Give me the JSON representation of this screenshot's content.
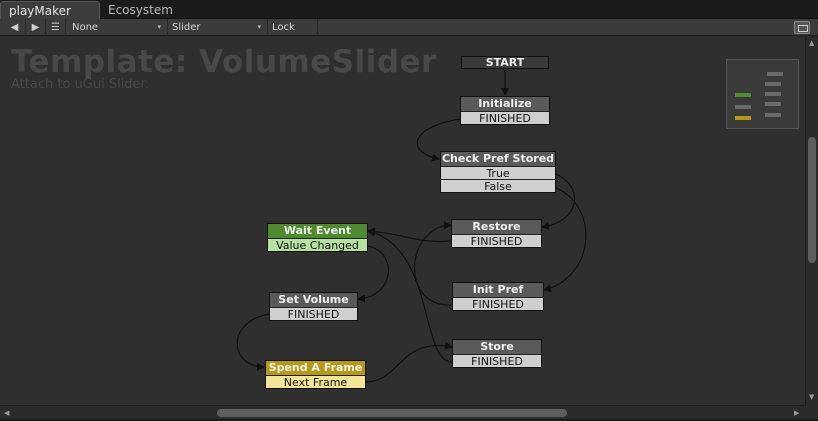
{
  "tabs": [
    {
      "label": "playMaker",
      "active": true
    },
    {
      "label": "Ecosystem",
      "active": false
    }
  ],
  "toolbar": {
    "back_icon": "◀",
    "forward_icon": "▶",
    "menu_icon": "☰",
    "fsm_select": "None",
    "object_select": "Slider",
    "lock_label": "Lock",
    "caret": "▾"
  },
  "canvas": {
    "title": "Template: VolumeSlider",
    "description": "Attach to uGui Slider."
  },
  "start_label": "START",
  "states": {
    "initialize": {
      "name": "Initialize",
      "events": [
        "FINISHED"
      ]
    },
    "check_pref": {
      "name": "Check Pref Stored",
      "events": [
        "True",
        "False"
      ]
    },
    "restore": {
      "name": "Restore",
      "events": [
        "FINISHED"
      ]
    },
    "wait_event": {
      "name": "Wait Event",
      "events": [
        "Value Changed"
      ]
    },
    "init_pref": {
      "name": "Init Pref",
      "events": [
        "FINISHED"
      ]
    },
    "set_volume": {
      "name": "Set Volume",
      "events": [
        "FINISHED"
      ]
    },
    "store": {
      "name": "Store",
      "events": [
        "FINISHED"
      ]
    },
    "spend_frame": {
      "name": "Spend A Frame",
      "events": [
        "Next Frame"
      ]
    }
  },
  "colors": {
    "active_state_header": "#4f8a30",
    "active_state_event": "#b7e1a0",
    "highlight_state_header": "#b59a1a",
    "highlight_state_event": "#f3e49a",
    "link_color": "#111111"
  },
  "scroll": {
    "left_arrow": "◀",
    "right_arrow": "▶",
    "up_arrow": "▲",
    "down_arrow": "▼"
  }
}
